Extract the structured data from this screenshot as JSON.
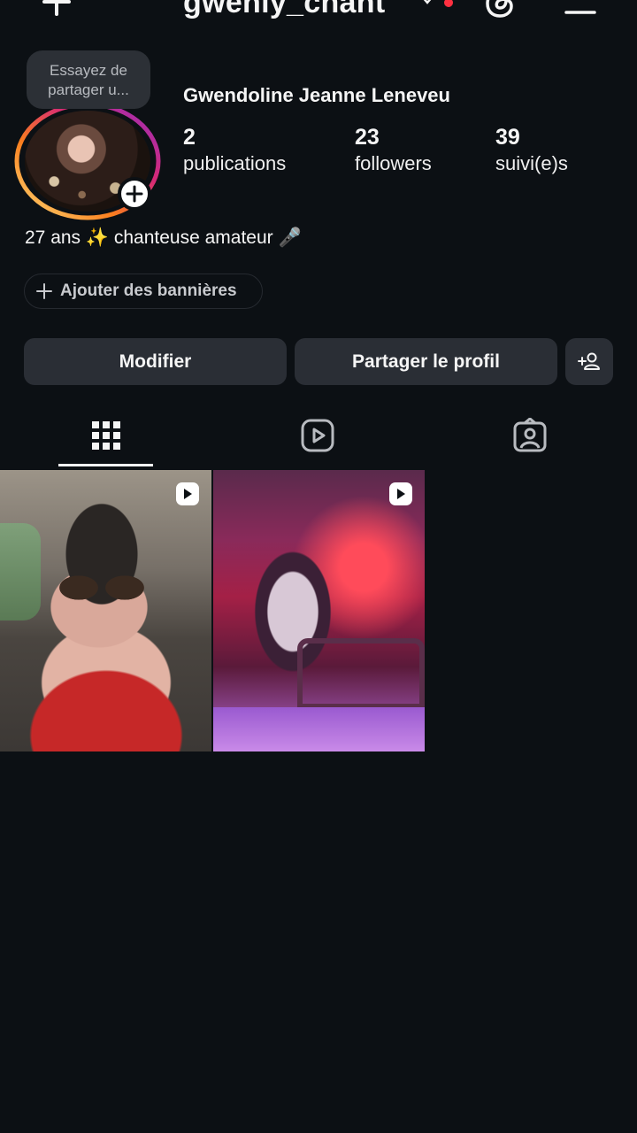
{
  "header": {
    "username": "gwenly_chant"
  },
  "tooltip": {
    "line1": "Essayez de",
    "line2": "partager u..."
  },
  "profile": {
    "full_name": "Gwendoline Jeanne Leneveu",
    "stats": [
      {
        "value": "2",
        "label": "publications"
      },
      {
        "value": "23",
        "label": "followers"
      },
      {
        "value": "39",
        "label": "suivi(e)s"
      }
    ],
    "bio": "27 ans ✨ chanteuse amateur 🎤"
  },
  "banners": {
    "label": "Ajouter des bannières"
  },
  "actions": {
    "edit_label": "Modifier",
    "share_label": "Partager le profil"
  },
  "tabs": [
    {
      "icon": "grid-icon",
      "active": true
    },
    {
      "icon": "reels-icon",
      "active": false
    },
    {
      "icon": "tagged-icon",
      "active": false
    }
  ],
  "posts": [
    {
      "type": "reel"
    },
    {
      "type": "reel"
    }
  ],
  "colors": {
    "background": "#0c1014",
    "button": "#2a2e35",
    "notification_dot": "#ff3040"
  }
}
